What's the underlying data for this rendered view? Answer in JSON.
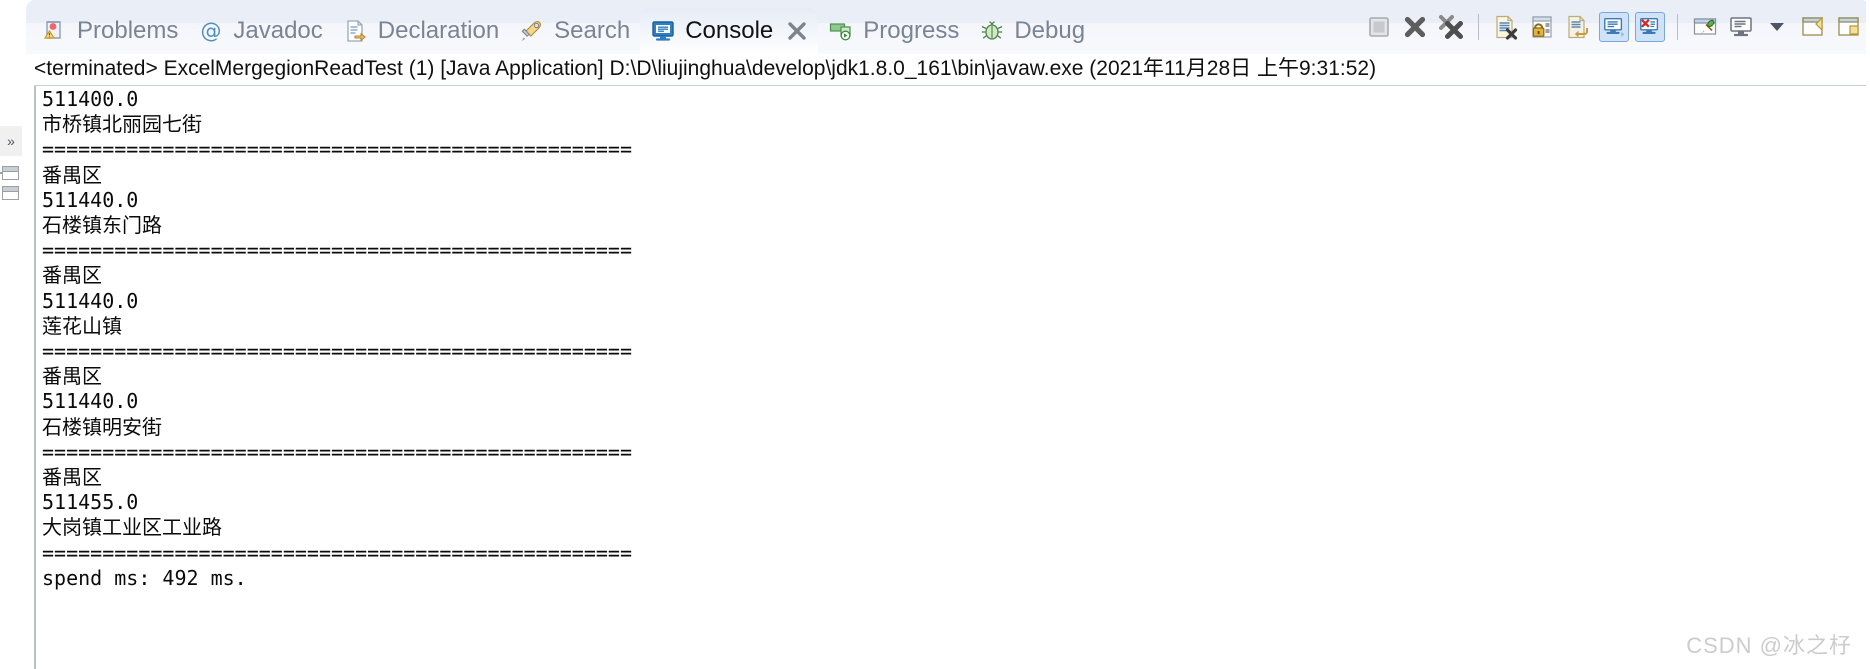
{
  "window": {
    "title": "Console",
    "watermark": "CSDN @冰之杍"
  },
  "tabs": [
    {
      "label": "Problems",
      "icon": "problems-icon",
      "active": false,
      "closable": false
    },
    {
      "label": "Javadoc",
      "icon": "javadoc-at-icon",
      "active": false,
      "closable": false
    },
    {
      "label": "Declaration",
      "icon": "declaration-icon",
      "active": false,
      "closable": false
    },
    {
      "label": "Search",
      "icon": "search-icon",
      "active": false,
      "closable": false
    },
    {
      "label": "Console",
      "icon": "console-icon",
      "active": true,
      "closable": true
    },
    {
      "label": "Progress",
      "icon": "progress-icon",
      "active": false,
      "closable": false
    },
    {
      "label": "Debug",
      "icon": "debug-bug-icon",
      "active": false,
      "closable": false
    }
  ],
  "tab_close_glyph": "✖",
  "toolbar": [
    {
      "name": "terminate-button",
      "icon": "stop-square-icon",
      "state": "disabled",
      "toggled": false
    },
    {
      "name": "remove-launch-button",
      "icon": "remove-x-icon",
      "state": "enabled",
      "toggled": false
    },
    {
      "name": "remove-all-terminated-button",
      "icon": "remove-all-x-icon",
      "state": "enabled",
      "toggled": false
    },
    {
      "name": "separator-1",
      "icon": "separator",
      "state": "static",
      "toggled": false
    },
    {
      "name": "clear-console-button",
      "icon": "clear-console-icon",
      "state": "enabled",
      "toggled": false
    },
    {
      "name": "scroll-lock-button",
      "icon": "scroll-lock-icon",
      "state": "enabled",
      "toggled": false
    },
    {
      "name": "word-wrap-button",
      "icon": "word-wrap-icon",
      "state": "enabled",
      "toggled": false
    },
    {
      "name": "show-console-on-output-button",
      "icon": "show-console-out-icon",
      "state": "enabled",
      "toggled": true
    },
    {
      "name": "show-console-on-error-button",
      "icon": "show-console-err-icon",
      "state": "enabled",
      "toggled": true
    },
    {
      "name": "separator-2",
      "icon": "separator",
      "state": "static",
      "toggled": false
    },
    {
      "name": "pin-console-button",
      "icon": "pin-console-icon",
      "state": "enabled",
      "toggled": false
    },
    {
      "name": "display-selected-console-button",
      "icon": "display-console-icon",
      "state": "enabled",
      "toggled": false
    },
    {
      "name": "console-dropdown-button",
      "icon": "chevron-down-icon",
      "state": "enabled",
      "toggled": false
    },
    {
      "name": "open-console-button",
      "icon": "open-console-icon",
      "state": "enabled",
      "toggled": false
    },
    {
      "name": "view-menu-button",
      "icon": "view-menu-icon",
      "state": "enabled",
      "toggled": false
    }
  ],
  "launch_header": {
    "status": "<terminated>",
    "config_name": "ExcelMergegionReadTest (1)",
    "launch_type": "[Java Application]",
    "jvm_path": "D:\\D\\liujinghua\\develop\\jdk1.8.0_161\\bin\\javaw.exe",
    "timestamp": "(2021年11月28日 上午9:31:52)",
    "full_text": "<terminated> ExcelMergegionReadTest (1) [Java Application] D:\\D\\liujinghua\\develop\\jdk1.8.0_161\\bin\\javaw.exe (2021年11月28日 上午9:31:52)"
  },
  "console_output": {
    "separator": "=================================================",
    "records": [
      {
        "postcode": "511400.0",
        "address": "市桥镇北丽园七街"
      },
      {
        "district": "番禺区",
        "postcode": "511440.0",
        "address": "石楼镇东门路"
      },
      {
        "district": "番禺区",
        "postcode": "511440.0",
        "address": "莲花山镇"
      },
      {
        "district": "番禺区",
        "postcode": "511440.0",
        "address": "石楼镇明安街"
      },
      {
        "district": "番禺区",
        "postcode": "511455.0",
        "address": "大岗镇工业区工业路"
      }
    ],
    "footer": "spend ms: 492 ms.",
    "lines": [
      "511400.0",
      "市桥镇北丽园七街",
      "=================================================",
      "番禺区",
      "511440.0",
      "石楼镇东门路",
      "=================================================",
      "番禺区",
      "511440.0",
      "莲花山镇",
      "=================================================",
      "番禺区",
      "511440.0",
      "石楼镇明安街",
      "=================================================",
      "番禺区",
      "511455.0",
      "大岗镇工业区工业路",
      "=================================================",
      "spend ms: 492 ms."
    ],
    "text": "511400.0\n市桥镇北丽园七街\n=================================================\n番禺区\n511440.0\n石楼镇东门路\n=================================================\n番禺区\n511440.0\n莲花山镇\n=================================================\n番禺区\n511440.0\n石楼镇明安街\n=================================================\n番禺区\n511455.0\n大岗镇工业区工业路\n=================================================\nspend ms: 492 ms."
  },
  "left_strip": {
    "restore_glyph": "»"
  },
  "colors": {
    "tab_bar_top": "#eaeef7",
    "active_tab_text": "#121212",
    "inactive_tab_text": "#7a8496",
    "toggle_highlight": "#cfe2f8",
    "console_text": "#0a0a0a",
    "watermark": "#cccccc"
  }
}
